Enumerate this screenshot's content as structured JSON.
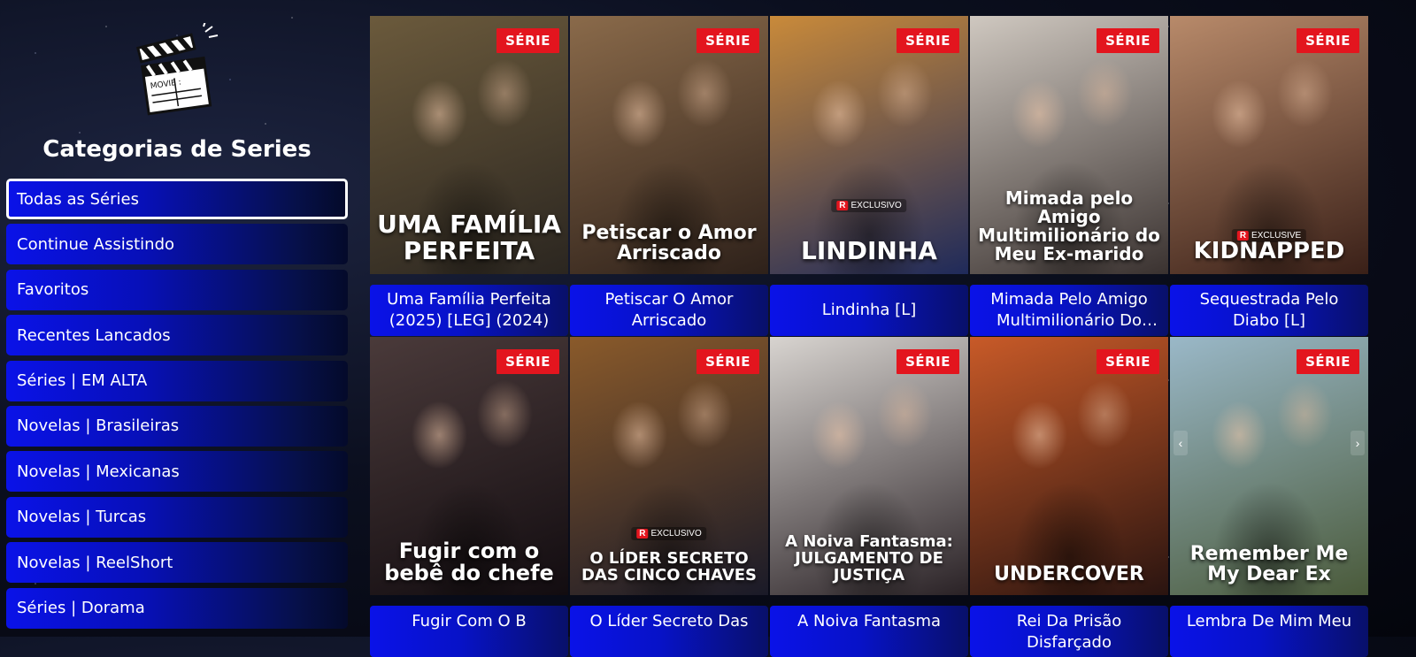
{
  "sidebar": {
    "title": "Categorias de Series",
    "logo_icon": "clapperboard-icon",
    "logo_text": "MOVIE :",
    "categories": [
      "Todas as Séries",
      "Continue Assistindo",
      "Favoritos",
      "Recentes Lancados",
      "Séries | EM ALTA",
      "Novelas | Brasileiras",
      "Novelas | Mexicanas",
      "Novelas | Turcas",
      "Novelas | ReelShort",
      "Séries | Dorama"
    ],
    "active_index": 0
  },
  "badge_label": "SÉRIE",
  "exclusive_label": "EXCLUSIVO",
  "exclusive_label_en": "EXCLUSIVE",
  "cards": [
    {
      "poster_text": "UMA FAMÍLIA PERFEITA",
      "caption": "Uma Família Perfeita (2025) [LEG] (2024)",
      "bg": [
        "#6b5a3c",
        "#2b2620"
      ]
    },
    {
      "poster_text": "Petiscar o Amor Arriscado",
      "caption": "Petiscar O Amor Arriscado",
      "bg": [
        "#8a6a4a",
        "#2e211a"
      ]
    },
    {
      "poster_text": "LINDINHA",
      "caption": "Lindinha [L]",
      "bg": [
        "#c98a3a",
        "#1f2a5a"
      ]
    },
    {
      "poster_text": "Mimada pelo Amigo Multimilionário do Meu Ex-marido",
      "caption": "Mimada Pelo Amigo Multimilionário Do Me…",
      "bg": [
        "#cfc8c0",
        "#3a3230"
      ]
    },
    {
      "poster_text": "KIDNAPPED",
      "caption": "Sequestrada Pelo Diabo [L]",
      "bg": [
        "#b88a6a",
        "#3a2018"
      ]
    },
    {
      "poster_text": "Fugir com o bebê do chefe",
      "caption": "Fugir Com O B",
      "bg": [
        "#4a3a3a",
        "#120c10"
      ]
    },
    {
      "poster_text": "O LÍDER SECRETO DAS CINCO CHAVES",
      "caption": "O Líder Secreto Das",
      "bg": [
        "#8a5a2a",
        "#1a1a28"
      ]
    },
    {
      "poster_text": "A Noiva Fantasma: JULGAMENTO DE JUSTIÇA",
      "caption": "A Noiva Fantasma",
      "bg": [
        "#d8d4d0",
        "#2a2226"
      ]
    },
    {
      "poster_text": "UNDERCOVER",
      "caption": "Rei Da Prisão Disfarçado",
      "bg": [
        "#c85a28",
        "#2a1410"
      ]
    },
    {
      "poster_text": "Remember Me My Dear Ex",
      "caption": "Lembra De Mim Meu",
      "bg": [
        "#9ab8c8",
        "#4a5a3a"
      ]
    }
  ]
}
